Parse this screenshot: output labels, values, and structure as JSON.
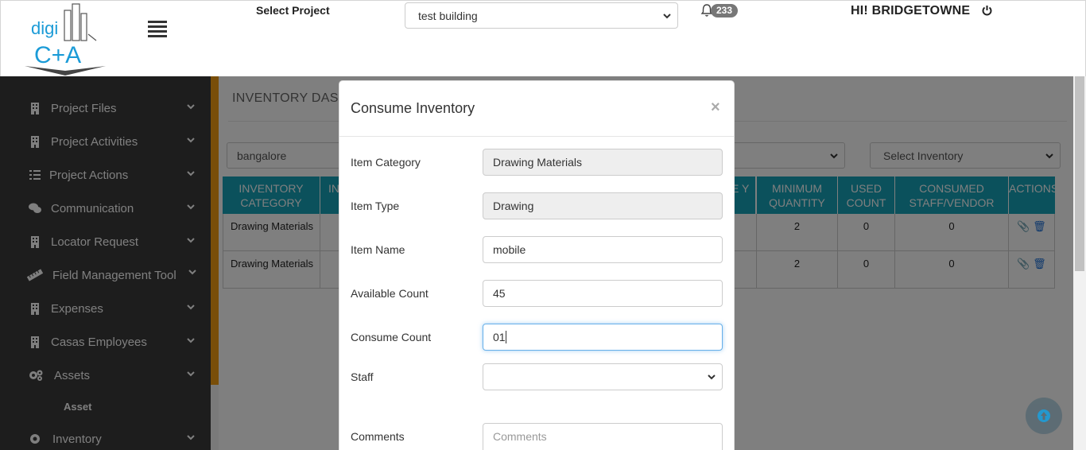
{
  "header": {
    "logo_text_top": "digi",
    "logo_text_bottom": "C+A",
    "select_project_label": "Select Project",
    "project_value": "test building",
    "notification_count": "233",
    "greeting": "HI! BRIDGETOWNE"
  },
  "sidebar": {
    "items": [
      {
        "label": "Project Files",
        "icon": "building-icon"
      },
      {
        "label": "Project Activities",
        "icon": "building-icon"
      },
      {
        "label": "Project Actions",
        "icon": "list-icon"
      },
      {
        "label": "Communication",
        "icon": "chat-icon"
      },
      {
        "label": "Locator Request",
        "icon": "building-icon"
      },
      {
        "label": "Field Management Tool",
        "icon": "ruler-icon"
      },
      {
        "label": "Expenses",
        "icon": "building-icon"
      },
      {
        "label": "Casas Employees",
        "icon": "building-icon"
      },
      {
        "label": "Assets",
        "icon": "gears-icon"
      },
      {
        "label": "Inventory",
        "icon": "gear-icon"
      }
    ],
    "sub_item": "Asset"
  },
  "dashboard": {
    "title": "INVENTORY DASHBOARD",
    "location_value": "bangalore",
    "inventory_select": "Select Inventory",
    "columns": [
      "INVENTORY CATEGORY",
      "IN",
      "E Y",
      "MINIMUM QUANTITY",
      "USED COUNT",
      "CONSUMED STAFF/VENDOR",
      "ACTIONS"
    ],
    "rows": [
      {
        "category": "Drawing Materials",
        "min_qty": "2",
        "used": "0",
        "consumed": "0"
      },
      {
        "category": "Drawing Materials",
        "min_qty": "2",
        "used": "0",
        "consumed": "0"
      }
    ]
  },
  "modal": {
    "title": "Consume Inventory",
    "close": "×",
    "fields": {
      "item_category_label": "Item Category",
      "item_category_value": "Drawing Materials",
      "item_type_label": "Item Type",
      "item_type_value": "Drawing",
      "item_name_label": "Item Name",
      "item_name_value": "mobile",
      "available_count_label": "Available Count",
      "available_count_value": "45",
      "consume_count_label": "Consume Count",
      "consume_count_value": "01",
      "staff_label": "Staff",
      "staff_value": "",
      "comments_label": "Comments",
      "comments_placeholder": "Comments"
    }
  },
  "colors": {
    "sidebar_bg": "#3a3a3a",
    "accent_orange": "#f39c12",
    "table_header": "#17a2b8",
    "overlay": "rgba(0,0,0,0.5)"
  }
}
